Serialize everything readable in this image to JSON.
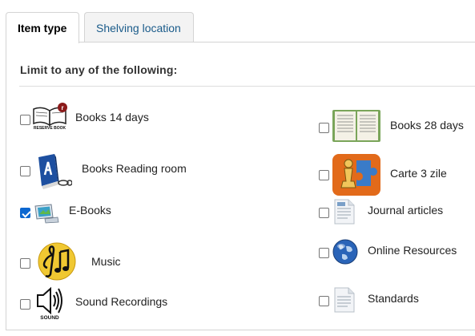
{
  "tabs": [
    {
      "label": "Item type",
      "active": true
    },
    {
      "label": "Shelving location",
      "active": false
    }
  ],
  "legend": "Limit to any of the following:",
  "items": [
    {
      "label": "Books 14 days",
      "checked": false,
      "icon": "reserve-book-icon",
      "icon_text": "RESERVE BOOK"
    },
    {
      "label": "Books 28 days",
      "checked": false,
      "icon": "open-book-icon"
    },
    {
      "label": "Books Reading room",
      "checked": false,
      "icon": "blue-book-icon"
    },
    {
      "label": "Carte 3 zile",
      "checked": false,
      "icon": "puzzle-chess-icon"
    },
    {
      "label": "E-Books",
      "checked": true,
      "icon": "ebook-screen-icon"
    },
    {
      "label": "Journal articles",
      "checked": false,
      "icon": "document-icon"
    },
    {
      "label": "Music",
      "checked": false,
      "icon": "music-note-icon"
    },
    {
      "label": "Online Resources",
      "checked": false,
      "icon": "globe-icon"
    },
    {
      "label": "Sound Recordings",
      "checked": false,
      "icon": "speaker-icon",
      "icon_text": "SOUND"
    },
    {
      "label": "Standards",
      "checked": false,
      "icon": "document-icon"
    }
  ],
  "colors": {
    "checked": "#0b67d0",
    "tab_link": "#1a5b8a"
  }
}
